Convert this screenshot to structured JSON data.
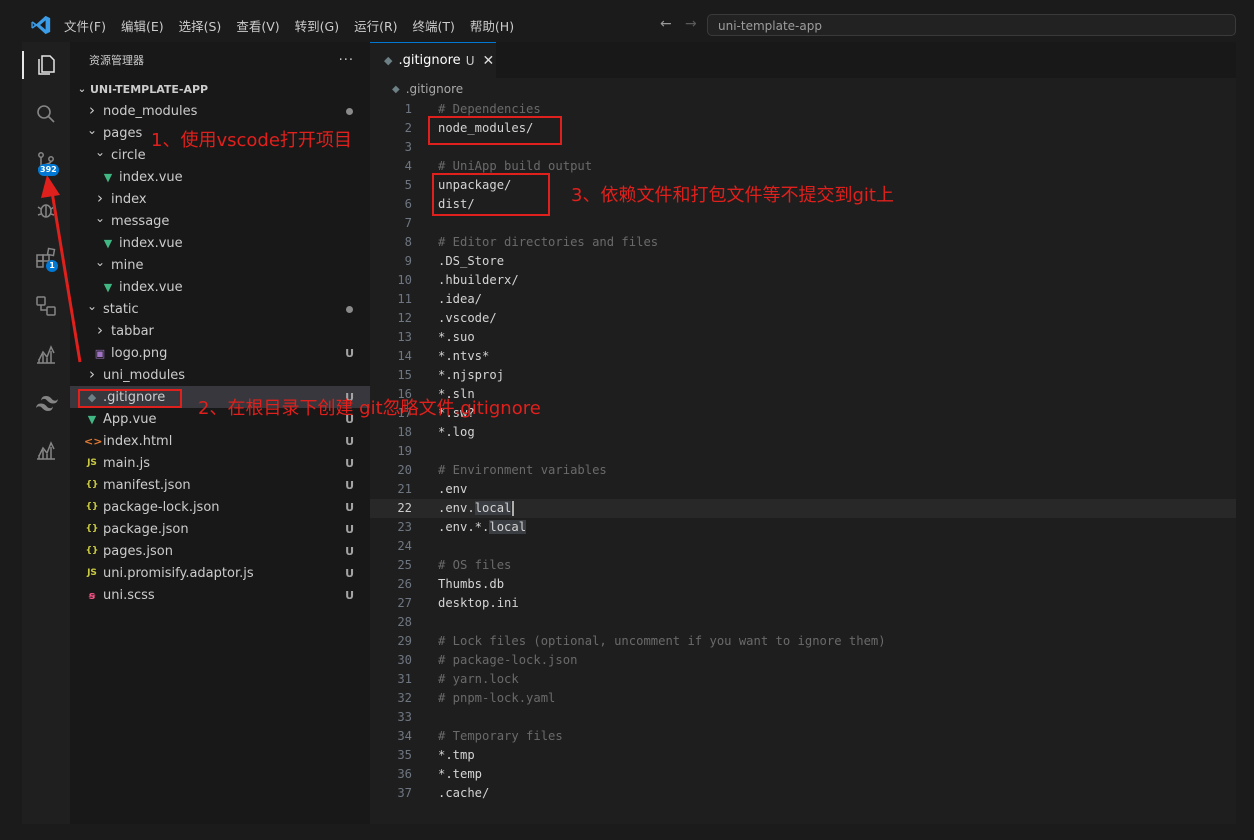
{
  "menu": [
    "文件(F)",
    "编辑(E)",
    "选择(S)",
    "查看(V)",
    "转到(G)",
    "运行(R)",
    "终端(T)",
    "帮助(H)"
  ],
  "search": {
    "value": "uni-template-app"
  },
  "activity": {
    "scm_badge": "392",
    "ext_badge": "1"
  },
  "sidebar": {
    "title": "资源管理器",
    "more": "···",
    "section": "UNI-TEMPLATE-APP",
    "items": [
      {
        "label": "node_modules",
        "depth": 0,
        "type": "folder-closed",
        "status": "dot"
      },
      {
        "label": "pages",
        "depth": 0,
        "type": "folder-open",
        "status": ""
      },
      {
        "label": "circle",
        "depth": 1,
        "type": "folder-open",
        "status": ""
      },
      {
        "label": "index.vue",
        "depth": 2,
        "type": "vue",
        "status": ""
      },
      {
        "label": "index",
        "depth": 1,
        "type": "folder-closed",
        "status": ""
      },
      {
        "label": "message",
        "depth": 1,
        "type": "folder-open",
        "status": ""
      },
      {
        "label": "index.vue",
        "depth": 2,
        "type": "vue",
        "status": ""
      },
      {
        "label": "mine",
        "depth": 1,
        "type": "folder-open",
        "status": ""
      },
      {
        "label": "index.vue",
        "depth": 2,
        "type": "vue",
        "status": ""
      },
      {
        "label": "static",
        "depth": 0,
        "type": "folder-open",
        "status": "dot"
      },
      {
        "label": "tabbar",
        "depth": 1,
        "type": "folder-closed",
        "status": ""
      },
      {
        "label": "logo.png",
        "depth": 1,
        "type": "png",
        "status": "U"
      },
      {
        "label": "uni_modules",
        "depth": 0,
        "type": "folder-closed",
        "status": ""
      },
      {
        "label": ".gitignore",
        "depth": 0,
        "type": "git",
        "status": "U",
        "selected": true
      },
      {
        "label": "App.vue",
        "depth": 0,
        "type": "vue",
        "status": "U"
      },
      {
        "label": "index.html",
        "depth": 0,
        "type": "html",
        "status": "U"
      },
      {
        "label": "main.js",
        "depth": 0,
        "type": "js",
        "status": "U"
      },
      {
        "label": "manifest.json",
        "depth": 0,
        "type": "json",
        "status": "U"
      },
      {
        "label": "package-lock.json",
        "depth": 0,
        "type": "json",
        "status": "U"
      },
      {
        "label": "package.json",
        "depth": 0,
        "type": "json",
        "status": "U"
      },
      {
        "label": "pages.json",
        "depth": 0,
        "type": "json",
        "status": "U"
      },
      {
        "label": "uni.promisify.adaptor.js",
        "depth": 0,
        "type": "js",
        "status": "U"
      },
      {
        "label": "uni.scss",
        "depth": 0,
        "type": "scss",
        "status": "U"
      }
    ]
  },
  "editor": {
    "tab": {
      "label": ".gitignore",
      "status": "U",
      "close": "✕"
    },
    "breadcrumb": ".gitignore",
    "current_line": 22,
    "lines": [
      "# Dependencies",
      "node_modules/",
      "",
      "# UniApp build output",
      "unpackage/",
      "dist/",
      "",
      "# Editor directories and files",
      ".DS_Store",
      ".hbuilderx/",
      ".idea/",
      ".vscode/",
      "*.suo",
      "*.ntvs*",
      "*.njsproj",
      "*.sln",
      "*.sw?",
      "*.log",
      "",
      "# Environment variables",
      ".env",
      ".env.local",
      ".env.*.local",
      "",
      "# OS files",
      "Thumbs.db",
      "desktop.ini",
      "",
      "# Lock files (optional, uncomment if you want to ignore them)",
      "# package-lock.json",
      "# yarn.lock",
      "# pnpm-lock.yaml",
      "",
      "# Temporary files",
      "*.tmp",
      "*.temp",
      ".cache/"
    ]
  },
  "annotations": {
    "a1": "1、使用vscode打开项目",
    "a2": "2、在根目录下创建 git忽略文件.gitignore",
    "a3": "3、依赖文件和打包文件等不提交到git上"
  },
  "colors": {
    "accent": "#0078d4",
    "annotation": "#e0201c",
    "vue": "#41b883",
    "json": "#cbcb41",
    "html": "#e37933",
    "js": "#cbcb41",
    "scss": "#f55385"
  }
}
